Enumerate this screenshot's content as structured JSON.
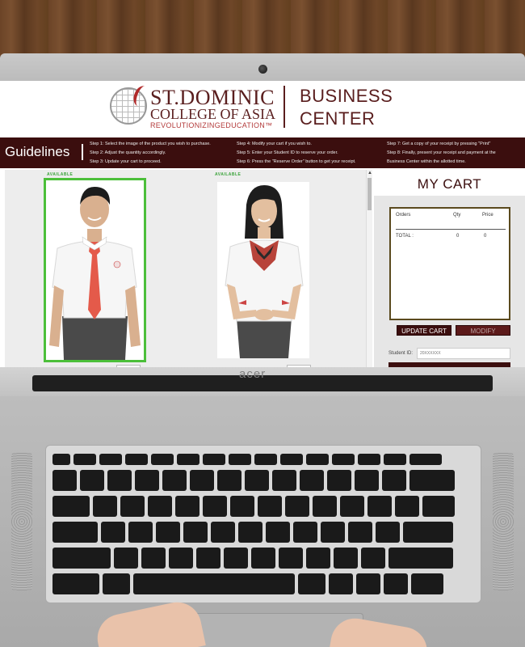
{
  "header": {
    "logo_line1": "ST.DOMINIC",
    "logo_line2": "COLLEGE OF ASIA",
    "logo_line3": "REVOLUTIONIZINGEDUCATION™",
    "business_line1": "BUSINESS",
    "business_line2": "CENTER"
  },
  "guidelines": {
    "title": "Guidelines",
    "steps": [
      "Step 1: Select the image of the product you wish to purchase.",
      "Step 2: Adjust the quantity accordingly.",
      "Step 3: Update your cart to proceed.",
      "Step 4: Modify your cart if you wish to.",
      "Step 5: Enter your Student ID to reserve your order.",
      "Step 6: Press the \"Reserve Order\" button to get your receipt.",
      "Step 7: Get a copy of your receipt by pressing \"Print\"",
      "Step 8: Finally, present your receipt and payment at the",
      "Business Center within the allotted time."
    ]
  },
  "products": [
    {
      "status": "AVAILABLE",
      "selected": true,
      "image": "male-uniform-photo"
    },
    {
      "status": "AVAILABLE",
      "selected": false,
      "image": "female-uniform-photo"
    }
  ],
  "cart": {
    "title": "MY CART",
    "headers": [
      "Orders",
      "Qty",
      "Price"
    ],
    "total_label": "TOTAL :",
    "total_qty": "0",
    "total_price": "0",
    "update_button": "UPDATE CART",
    "modify_button": "MODIFY",
    "student_id_label": "Student ID:",
    "student_id_placeholder": "20XXXXXX"
  },
  "laptop": {
    "brand": "acer"
  },
  "colors": {
    "maroon": "#3b0e0e",
    "selected_border": "#4cbf3a",
    "available_text": "#3aa33a"
  }
}
